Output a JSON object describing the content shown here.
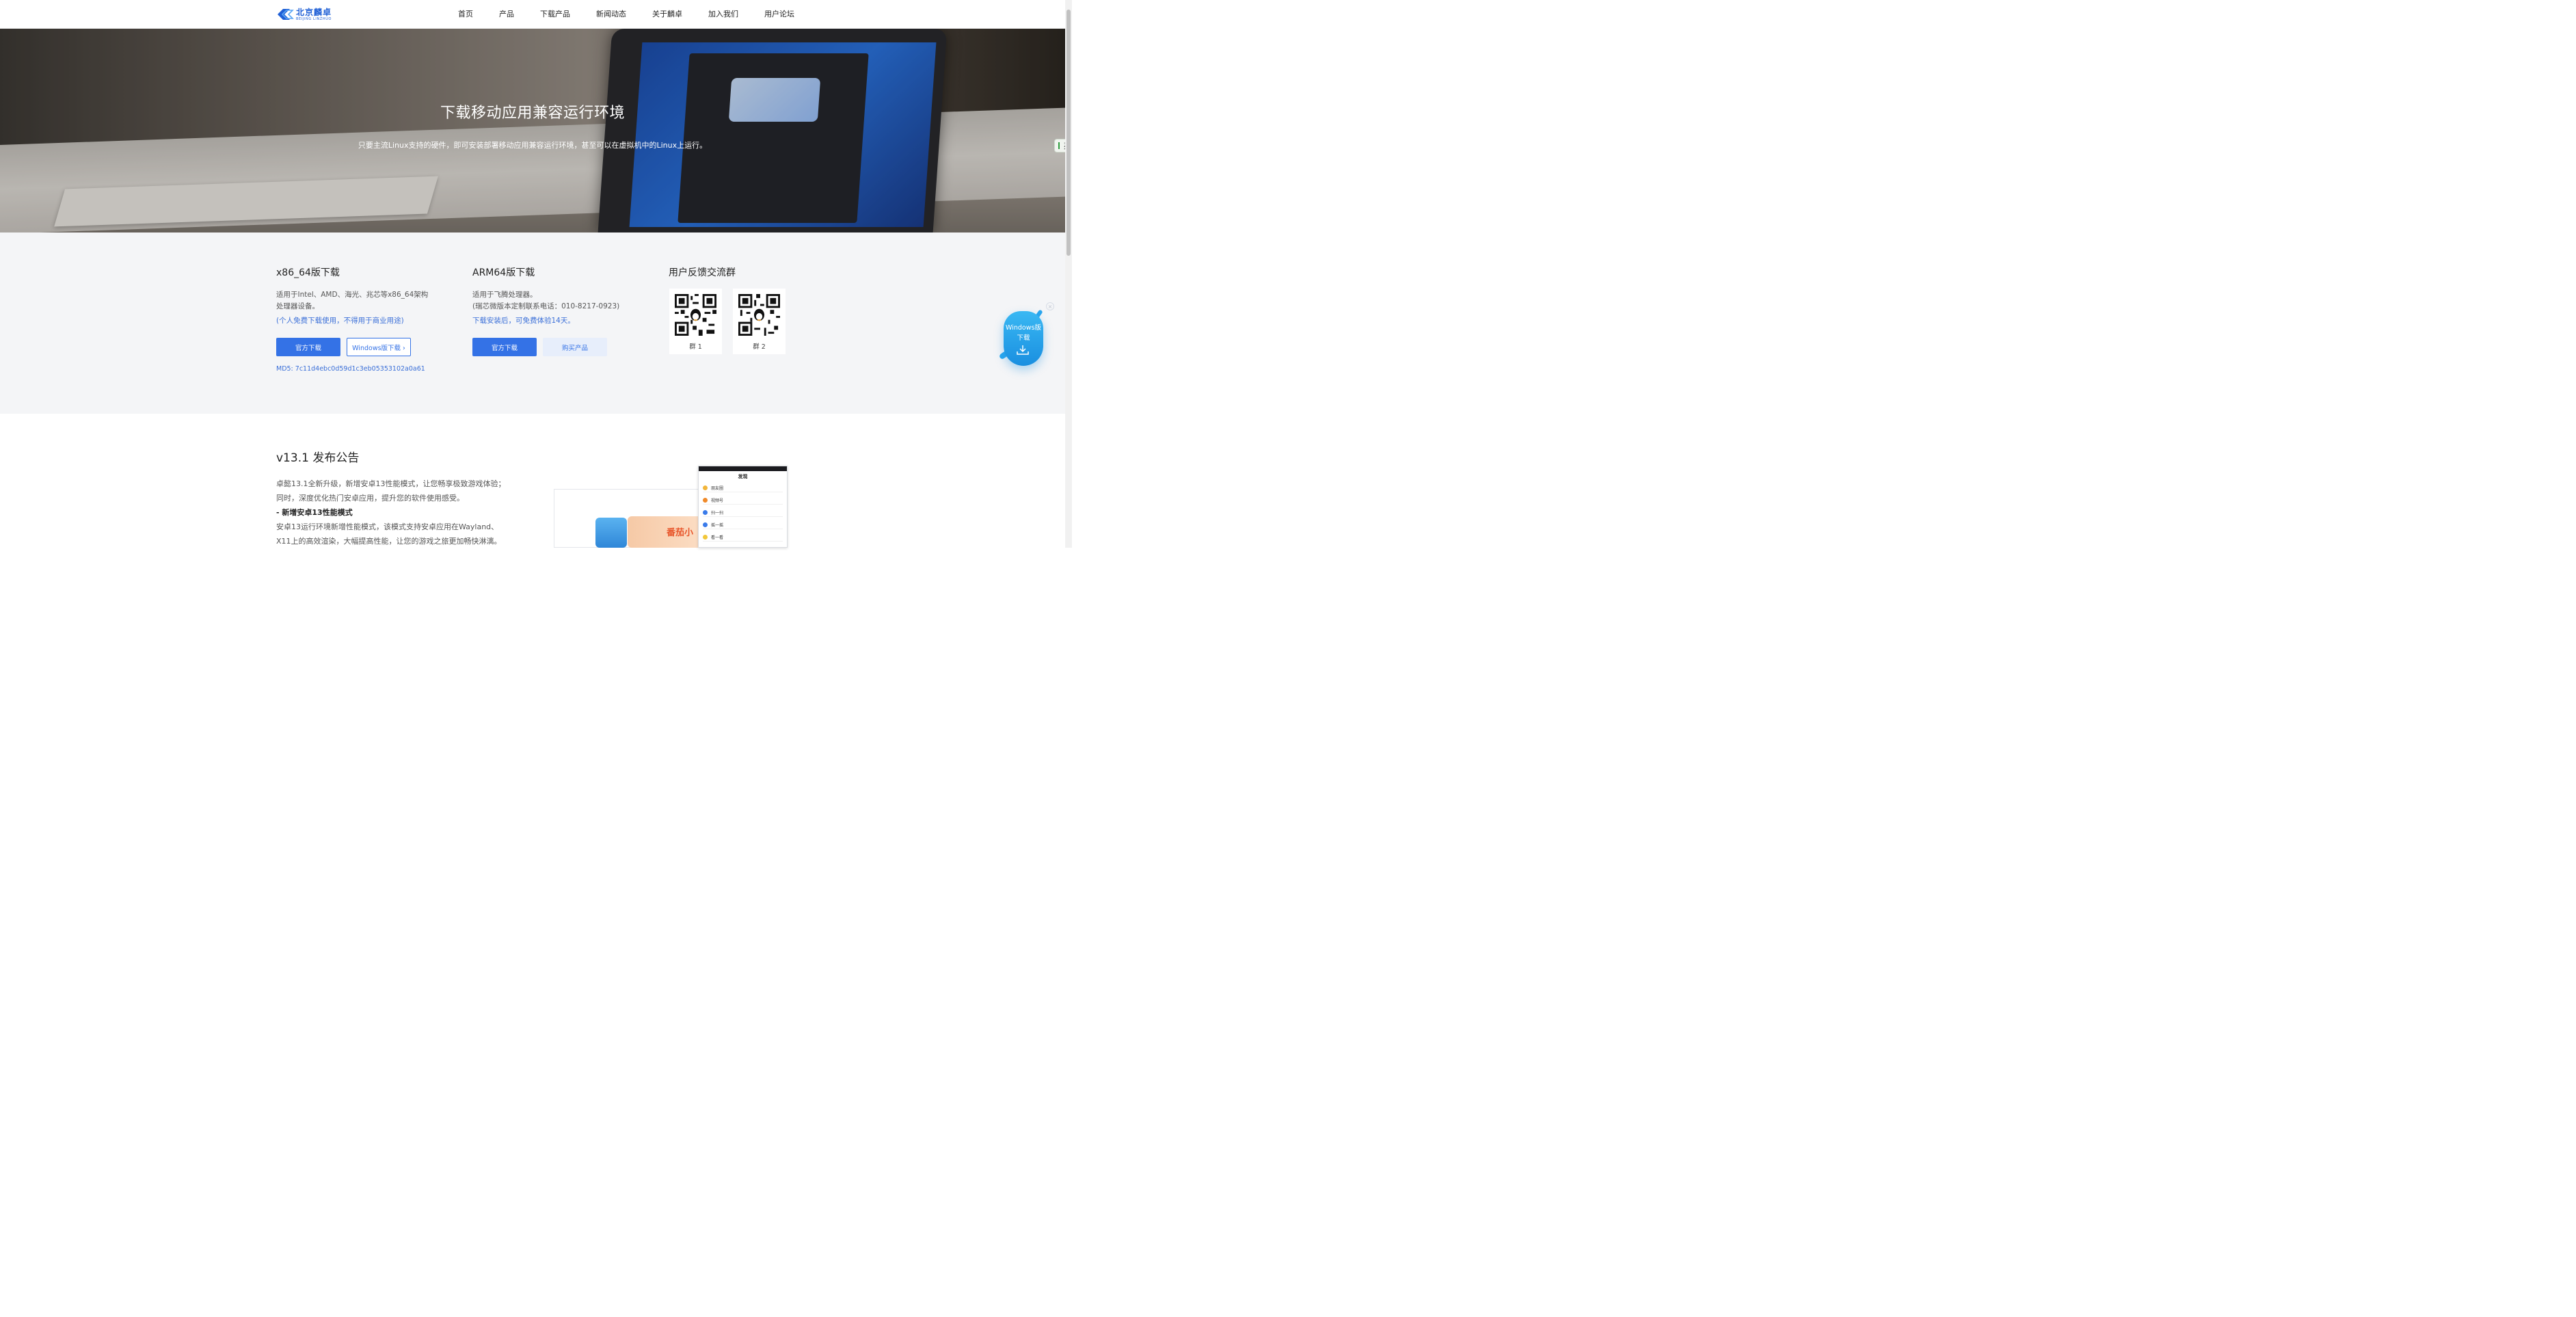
{
  "nav": {
    "logo_cn": "北京麟卓",
    "logo_en": "BEIJING LINZHUO",
    "items": [
      "首页",
      "产品",
      "下载产品",
      "新闻动态",
      "关于麟卓",
      "加入我们",
      "用户论坛"
    ]
  },
  "hero": {
    "title": "下载移动应用兼容运行环境",
    "subtitle": "只要主流Linux支持的硬件，即可安装部署移动应用兼容运行环境，甚至可以在虚拟机中的Linux上运行。"
  },
  "x86": {
    "title": "x86_64版下载",
    "desc_line1": "适用于Intel、AMD、海光、兆芯等x86_64架构",
    "desc_line2": "处理器设备。",
    "note": "(个人免费下载使用，不得用于商业用途)",
    "btn_official": "官方下载",
    "btn_windows": "Windows版下载 ›",
    "md5": "MD5: 7c11d4ebc0d59d1c3eb05353102a0a61"
  },
  "arm": {
    "title": "ARM64版下载",
    "desc_line1": "适用于飞腾处理器。",
    "desc_line2": "(瑞芯微版本定制联系电话：010-8217-0923)",
    "note": "下载安装后，可免费体验14天。",
    "btn_official": "官方下载",
    "btn_buy": "购买产品"
  },
  "feedback": {
    "title": "用户反馈交流群",
    "group1": "群 1",
    "group2": "群 2"
  },
  "float_widget": {
    "line1": "Windows版",
    "line2": "下载",
    "close": "×"
  },
  "side_tab": {
    "label": "英"
  },
  "release": {
    "title": "v13.1 发布公告",
    "p1": "卓懿13.1全新升级，新增安卓13性能模式，让您畅享极致游戏体验；",
    "p2": "同时，深度优化热门安卓应用，提升您的软件使用感受。",
    "h1": "- 新增安卓13性能模式",
    "p3": "安卓13运行环境新增性能模式，该模式支持安卓应用在Wayland、",
    "p4": "X11上的高效渲染，大幅提高性能，让您的游戏之旅更加畅快淋漓。"
  },
  "screenshot": {
    "front_title": "发现",
    "rows": [
      "朋友圈",
      "视频号",
      "扫一扫",
      "摇一摇",
      "看一看"
    ],
    "banner_text": "番茄小"
  },
  "colors": {
    "primary": "#3472e6",
    "link": "#3a6fd8",
    "section_bg": "#f4f5f7"
  }
}
